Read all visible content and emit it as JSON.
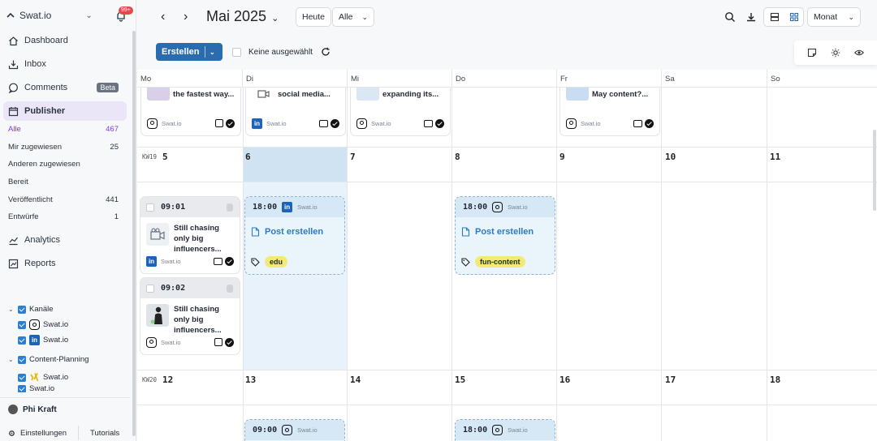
{
  "brand": {
    "name": "Swat.io",
    "notifications": "99+"
  },
  "nav": {
    "dashboard": "Dashboard",
    "inbox": "Inbox",
    "comments": "Comments",
    "beta": "Beta",
    "publisher": "Publisher",
    "analytics": "Analytics",
    "reports": "Reports"
  },
  "filters": [
    {
      "label": "Alle",
      "count": "467"
    },
    {
      "label": "Mir zugewiesen",
      "count": "25"
    },
    {
      "label": "Anderen zugewiesen",
      "count": ""
    },
    {
      "label": "Bereit",
      "count": ""
    },
    {
      "label": "Veröffentlicht",
      "count": "441"
    },
    {
      "label": "Entwürfe",
      "count": "1"
    }
  ],
  "tree": {
    "channels": "Kanäle",
    "channel_a": "Swat.io",
    "channel_b": "Swat.io",
    "content_planning": "Content-Planning",
    "planning_a": "Swat.io",
    "planning_b": "Swat.io"
  },
  "footer": {
    "user": "Phi Kraft",
    "settings": "Einstellungen",
    "tutorials": "Tutorials"
  },
  "topbar": {
    "month": "Mai 2025",
    "today": "Heute",
    "filter": "Alle",
    "view": "Monat"
  },
  "toolbar": {
    "create": "Erstellen",
    "selection": "Keine ausgewählt"
  },
  "weekdays": [
    "Mo",
    "Di",
    "Mi",
    "Do",
    "Fr",
    "Sa",
    "So"
  ],
  "week1": {
    "kw": "KW19",
    "days": [
      "5",
      "6",
      "7",
      "8",
      "9",
      "10",
      "11"
    ]
  },
  "week2": {
    "kw": "KW20",
    "days": [
      "12",
      "13",
      "14",
      "15",
      "16",
      "17",
      "18"
    ]
  },
  "top_cards": [
    "the fastest way...",
    "social media...",
    "expanding its...",
    "May content?..."
  ],
  "account": "Swat.io",
  "posts": [
    {
      "time": "09:01",
      "text": "Still chasing only big influencers..."
    },
    {
      "time": "09:02",
      "text": "Still chasing only big influencers..."
    }
  ],
  "drafts": [
    {
      "time": "18:00",
      "action": "Post erstellen",
      "tag": "edu"
    },
    {
      "time": "18:00",
      "action": "Post erstellen",
      "tag": "fun-content"
    }
  ],
  "next_drafts": [
    "09:00",
    "18:00"
  ]
}
